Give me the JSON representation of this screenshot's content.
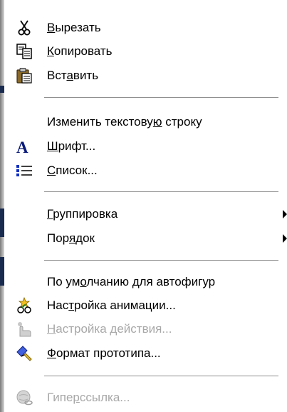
{
  "menu": {
    "items": [
      {
        "id": "cut",
        "pre": "",
        "u": "В",
        "post": "ырезать",
        "icon": "scissors-icon",
        "enabled": true
      },
      {
        "id": "copy",
        "pre": "",
        "u": "К",
        "post": "опировать",
        "icon": "copy-icon",
        "enabled": true
      },
      {
        "id": "paste",
        "pre": "Вст",
        "u": "а",
        "post": "вить",
        "icon": "paste-icon",
        "enabled": true
      },
      {
        "id": "edit-text",
        "pre": "Изменить текстову",
        "u": "ю",
        "post": " строку",
        "icon": "",
        "enabled": true
      },
      {
        "id": "font",
        "pre": "",
        "u": "Ш",
        "post": "рифт...",
        "icon": "font-icon",
        "enabled": true
      },
      {
        "id": "list",
        "pre": "",
        "u": "С",
        "post": "писок...",
        "icon": "list-icon",
        "enabled": true
      },
      {
        "id": "group",
        "pre": "",
        "u": "Г",
        "post": "руппировка",
        "icon": "",
        "enabled": true,
        "submenu": true
      },
      {
        "id": "order",
        "pre": "Пор",
        "u": "я",
        "post": "док",
        "icon": "",
        "enabled": true,
        "submenu": true
      },
      {
        "id": "autoshape-default",
        "pre": "По ум",
        "u": "о",
        "post": "лчанию для автофигур",
        "icon": "",
        "enabled": true
      },
      {
        "id": "animation",
        "pre": "Нас",
        "u": "т",
        "post": "ройка анимации...",
        "icon": "animation-icon",
        "enabled": true
      },
      {
        "id": "action",
        "pre": "",
        "u": "Н",
        "post": "астройка действия...",
        "icon": "action-icon",
        "enabled": false
      },
      {
        "id": "format-prototype",
        "pre": "",
        "u": "Ф",
        "post": "ормат прототипа...",
        "icon": "format-icon",
        "enabled": true
      },
      {
        "id": "hyperlink",
        "pre": "Гипе",
        "u": "р",
        "post": "ссылка...",
        "icon": "hyperlink-icon",
        "enabled": false
      }
    ]
  },
  "colors": {
    "background": "#ffffff",
    "text": "#000000",
    "disabled_text": "#a8a8a8",
    "separator": "#8f8f8f",
    "edge_dark": "#1a2b50"
  }
}
